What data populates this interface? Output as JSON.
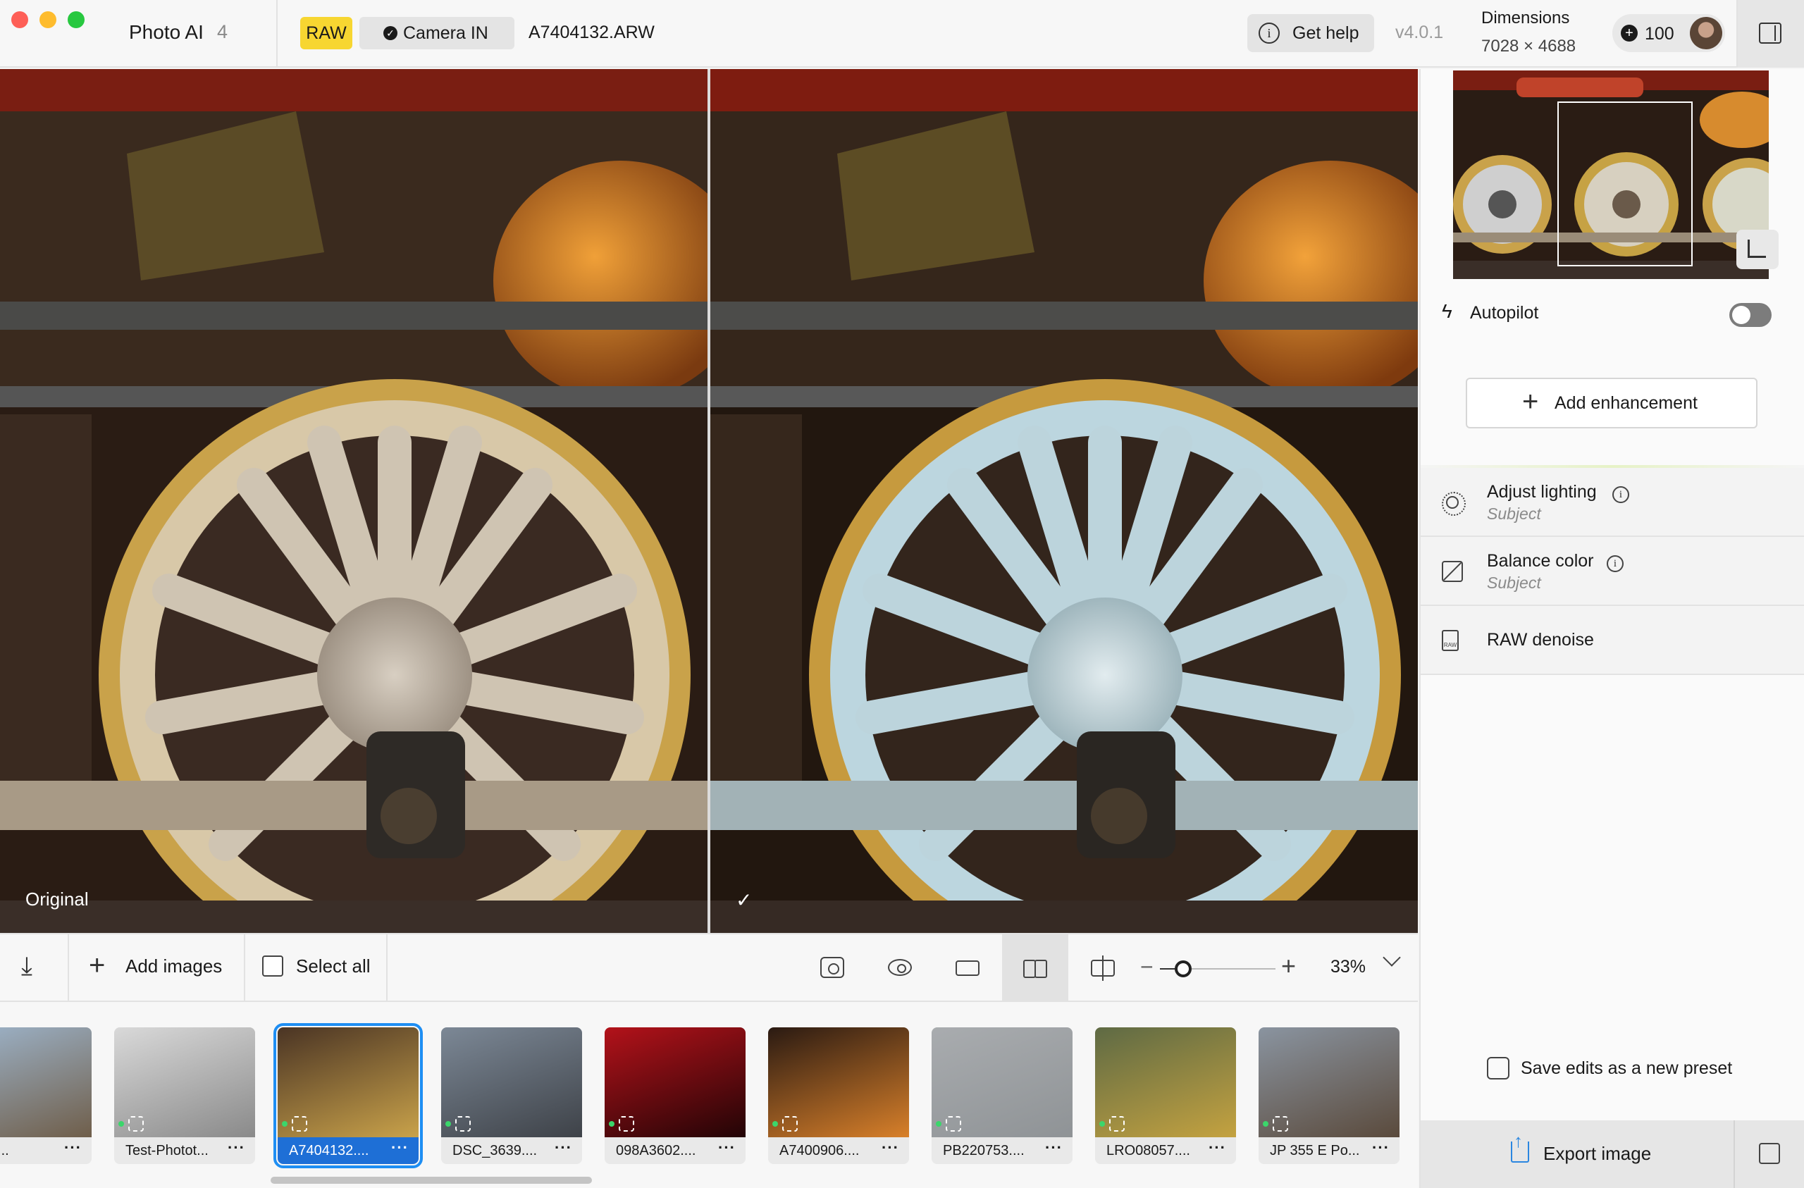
{
  "app": {
    "title": "Photo AI",
    "version_badge": "4",
    "release": "v4.0.1"
  },
  "header": {
    "raw_badge": "RAW",
    "camera_badge": "Camera IN",
    "file_name": "A7404132.ARW",
    "help_label": "Get help",
    "dimensions_label": "Dimensions",
    "dimensions_value": "7028 × 4688",
    "credits": "100"
  },
  "viewer": {
    "left_label": "Original",
    "right_label": "✓"
  },
  "toolbar": {
    "add_images": "Add images",
    "select_all": "Select all",
    "zoom_value": "33%",
    "zoom_level": 0.2
  },
  "filmstrip": [
    {
      "name": "_remi...",
      "selected": false
    },
    {
      "name": "Test-Photot...",
      "selected": false
    },
    {
      "name": "A7404132....",
      "selected": true
    },
    {
      "name": "DSC_3639....",
      "selected": false
    },
    {
      "name": "098A3602....",
      "selected": false
    },
    {
      "name": "A7400906....",
      "selected": false
    },
    {
      "name": "PB220753....",
      "selected": false
    },
    {
      "name": "LRO08057....",
      "selected": false
    },
    {
      "name": "JP 355 E Po...",
      "selected": false
    }
  ],
  "panel": {
    "autopilot": "Autopilot",
    "autopilot_on": false,
    "add_enhancement": "Add enhancement",
    "enhancements": [
      {
        "title": "Adjust lighting",
        "subtitle": "Subject",
        "icon": "sun-icon"
      },
      {
        "title": "Balance color",
        "subtitle": "Subject",
        "icon": "balance-icon"
      },
      {
        "title": "RAW denoise",
        "subtitle": "",
        "icon": "raw-file-icon"
      }
    ],
    "save_preset": "Save edits as a new preset",
    "export": "Export image"
  },
  "colors": {
    "raw_badge": "#f7d631",
    "selection": "#1e8ef3",
    "export_icon": "#2a86e0"
  }
}
